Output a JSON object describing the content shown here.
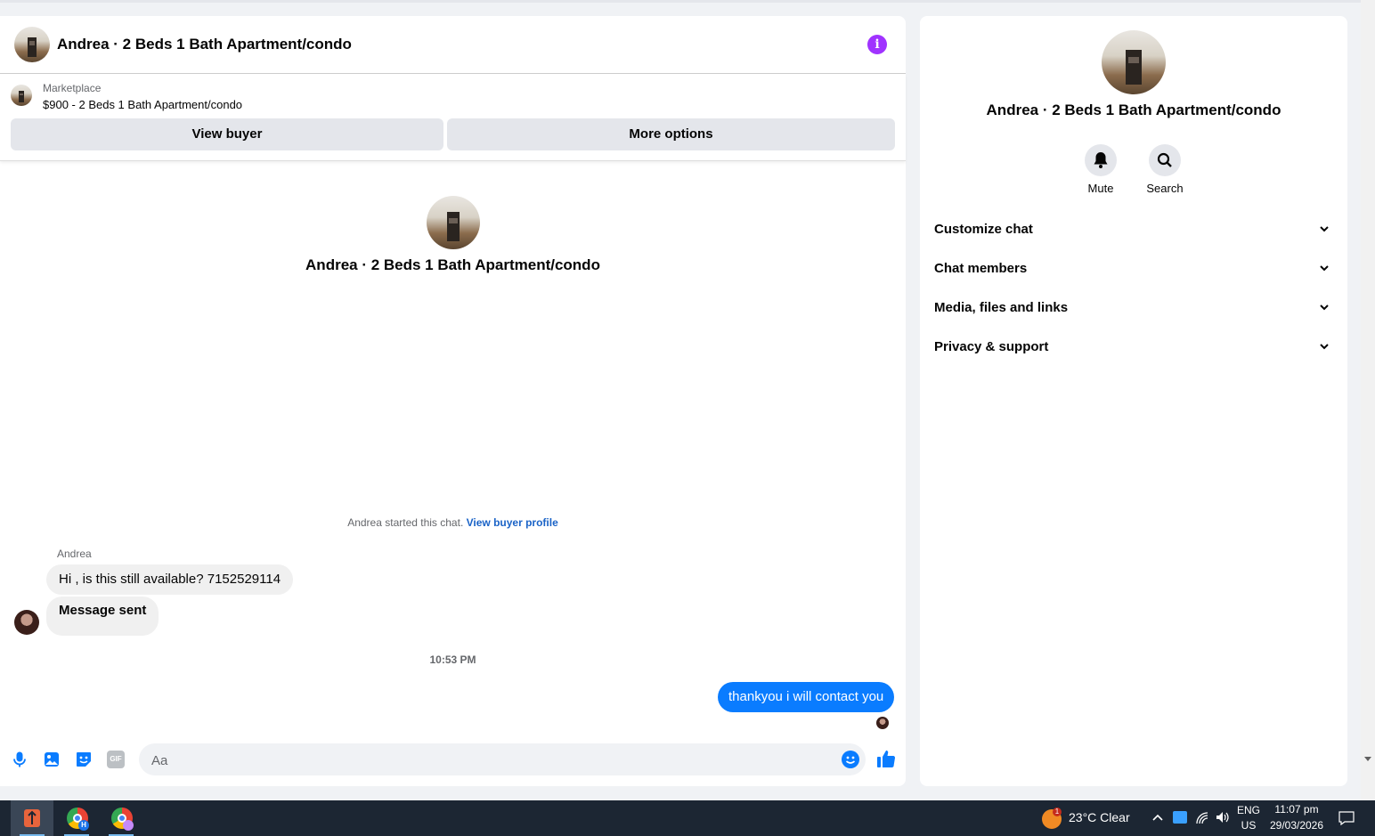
{
  "header": {
    "title": "Andrea · 2 Beds 1 Bath Apartment/condo",
    "info_icon": "info-icon",
    "info_color": "#a033ff"
  },
  "marketplace": {
    "label": "Marketplace",
    "item": "$900 - 2 Beds 1 Bath Apartment/condo",
    "view_buyer": "View buyer",
    "more_options": "More options"
  },
  "conversation": {
    "name": "Andrea · 2 Beds 1 Bath Apartment/condo",
    "started_text": "Andrea started this chat.",
    "started_link": "View buyer profile",
    "sender": "Andrea",
    "messages_in": [
      "Hi , is this still available? 7152529114",
      "Message sent"
    ],
    "timestamp": "10:53 PM",
    "message_out": "thankyou i will contact you",
    "outgoing_color": "#0a7cff"
  },
  "composer": {
    "placeholder": "Aa",
    "icons": [
      "microphone-icon",
      "image-icon",
      "sticker-icon",
      "gif-icon",
      "emoji-icon",
      "like-icon"
    ],
    "gif_label": "GIF",
    "accent": "#0a7cff"
  },
  "sidebar": {
    "name": "Andrea · 2 Beds 1 Bath Apartment/condo",
    "mute": "Mute",
    "search": "Search",
    "sections": [
      "Customize chat",
      "Chat members",
      "Media, files and links",
      "Privacy & support"
    ]
  },
  "taskbar": {
    "weather_badge": "1",
    "weather": "23°C  Clear",
    "lang_1": "ENG",
    "lang_2": "US",
    "time": "11:07 pm",
    "date": "29/03/2026",
    "chrome_badge": "H"
  }
}
